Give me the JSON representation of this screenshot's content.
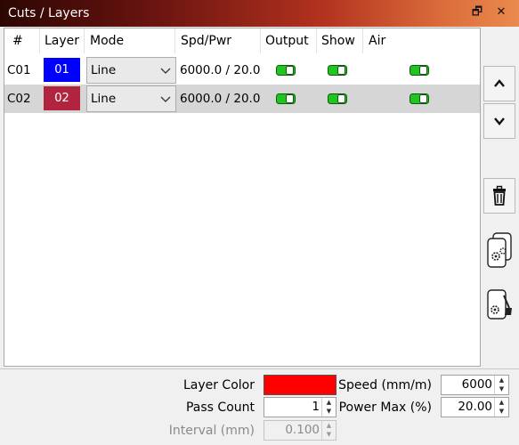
{
  "window": {
    "title": "Cuts / Layers",
    "float_glyph": "🗗",
    "close_glyph": "✕"
  },
  "table": {
    "headers": {
      "num": "#",
      "layer": "Layer",
      "mode": "Mode",
      "spd_pwr": "Spd/Pwr",
      "output": "Output",
      "show": "Show",
      "air": "Air"
    },
    "rows": [
      {
        "num": "C01",
        "layer": "01",
        "layer_color": "#0000ff",
        "mode": "Line",
        "spd_pwr": "6000.0 / 20.0",
        "output": true,
        "show": true,
        "air": true,
        "selected": false
      },
      {
        "num": "C02",
        "layer": "02",
        "layer_color": "#b02440",
        "mode": "Line",
        "spd_pwr": "6000.0 / 20.0",
        "output": true,
        "show": true,
        "air": true,
        "selected": true
      }
    ]
  },
  "side_buttons": [
    "chevron-up-icon",
    "chevron-down-icon",
    "trash-icon",
    "copy-settings-icon",
    "apply-settings-icon"
  ],
  "settings": {
    "layer_color_label": "Layer Color",
    "layer_color": "#ff0000",
    "pass_count_label": "Pass Count",
    "pass_count": "1",
    "interval_label": "Interval (mm)",
    "interval": "0.100",
    "speed_label": "Speed (mm/m)",
    "speed": "6000",
    "power_max_label": "Power Max (%)",
    "power_max": "20.00"
  },
  "colors": {
    "toggle_on": "#22c422",
    "title_gradient_end": "#ea8a4e"
  }
}
